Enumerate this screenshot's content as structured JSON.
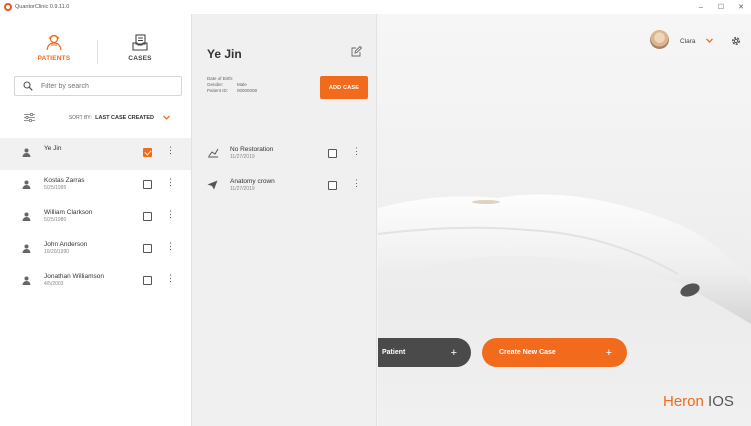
{
  "window": {
    "title": "QuantorClinic 0.9.11.0",
    "controls": {
      "minimize": "–",
      "maximize": "☐",
      "close": "✕"
    }
  },
  "nav": {
    "patients_label": "PATIENTS",
    "cases_label": "CASES"
  },
  "search": {
    "placeholder": "Filter by search"
  },
  "sort": {
    "prefix": "SORT BY:",
    "value": "LAST CASE CREATED"
  },
  "patients": [
    {
      "name": "Ye Jin",
      "date": "",
      "selected": true,
      "checked": true
    },
    {
      "name": "Kostas Zarras",
      "date": "5/25/1995",
      "selected": false,
      "checked": false
    },
    {
      "name": "William Clarkson",
      "date": "5/25/1980",
      "selected": false,
      "checked": false
    },
    {
      "name": "John Anderson",
      "date": "10/20/1990",
      "selected": false,
      "checked": false
    },
    {
      "name": "Jonathan Williamson",
      "date": "4/5/2003",
      "selected": false,
      "checked": false
    }
  ],
  "patient_detail": {
    "name": "Ye Jin",
    "dob_label": "Date of Birth:",
    "gender_label": "Gender:",
    "gender_value": "Male",
    "id_label": "Patient ID:",
    "id_value": "00000008",
    "add_case_label": "ADD CASE"
  },
  "cases": [
    {
      "name": "No Restoration",
      "date": "11/27/2019",
      "icon": "restoration-icon"
    },
    {
      "name": "Anatomy crown",
      "date": "11/27/2019",
      "icon": "send-icon"
    }
  ],
  "user": {
    "name": "Clara"
  },
  "actions": {
    "new_patient_label": "Patient",
    "new_case_label": "Create New Case",
    "plus": "+"
  },
  "brand": {
    "part1": "Heron",
    "part2": "IOS"
  },
  "colors": {
    "accent": "#f26a1c",
    "dark_button": "#4a4a4a"
  }
}
